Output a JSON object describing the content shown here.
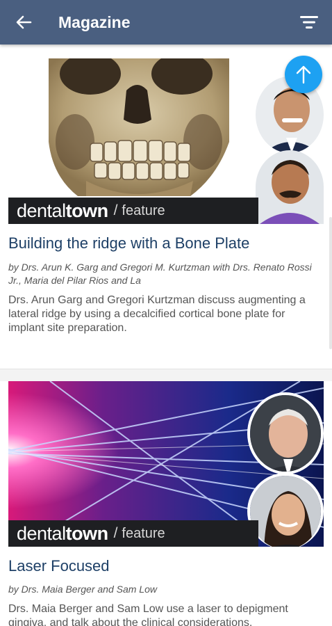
{
  "appbar": {
    "title": "Magazine",
    "back_icon": "arrow-left-icon",
    "filter_icon": "filter-icon",
    "background": "#4a5f80"
  },
  "fab": {
    "icon": "arrow-up-icon",
    "color": "#1da1f2"
  },
  "articles": [
    {
      "brand_prefix": "dental",
      "brand_suffix": "town",
      "brand_slash": "/",
      "brand_section": "feature",
      "title": "Building the ridge with a Bone Plate",
      "byline": "by Drs. Arun K. Garg and Gregori M. Kurtzman with Drs. Renato Rossi Jr., Maria del Pilar Rios and La",
      "summary": "Drs. Arun Garg and Gregori Kurtzman discuss augmenting a lateral ridge by using a decalcified cortical bone plate for implant site preparation."
    },
    {
      "brand_prefix": "dental",
      "brand_suffix": "town",
      "brand_slash": "/",
      "brand_section": "feature",
      "title": "Laser Focused",
      "byline": "by Drs. Maia Berger and Sam Low",
      "summary": "Drs. Maia Berger and Sam Low use a laser to depigment gingiva, and talk about the clinical considerations."
    }
  ],
  "colors": {
    "title_link": "#1d3f66",
    "brand_bar": "#1e1f22"
  }
}
